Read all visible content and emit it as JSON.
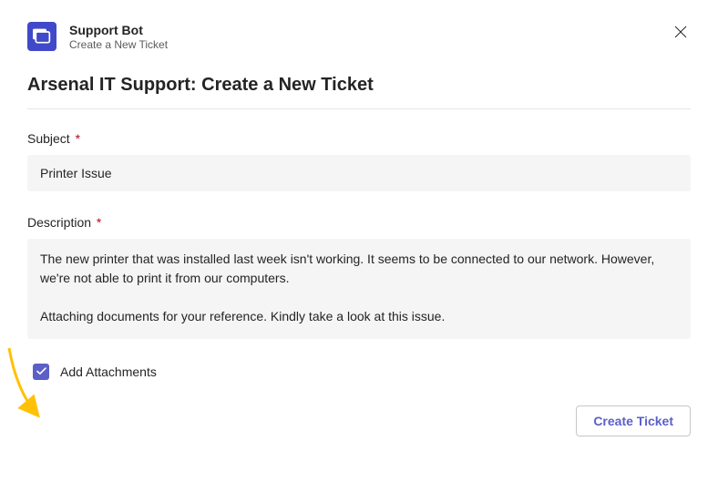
{
  "header": {
    "app_title": "Support Bot",
    "app_subtitle": "Create a New Ticket"
  },
  "page_title": "Arsenal IT Support: Create a New Ticket",
  "form": {
    "subject_label": "Subject",
    "subject_value": "Printer Issue",
    "description_label": "Description",
    "description_value": "The new printer that was installed last week isn't working. It seems to be connected to our network. However, we're not able to print it from our computers.\n\nAttaching documents for your reference. Kindly take a look at this issue.",
    "attachments_label": "Add Attachments",
    "attachments_checked": true
  },
  "actions": {
    "create_label": "Create Ticket"
  },
  "required_marker": "*"
}
